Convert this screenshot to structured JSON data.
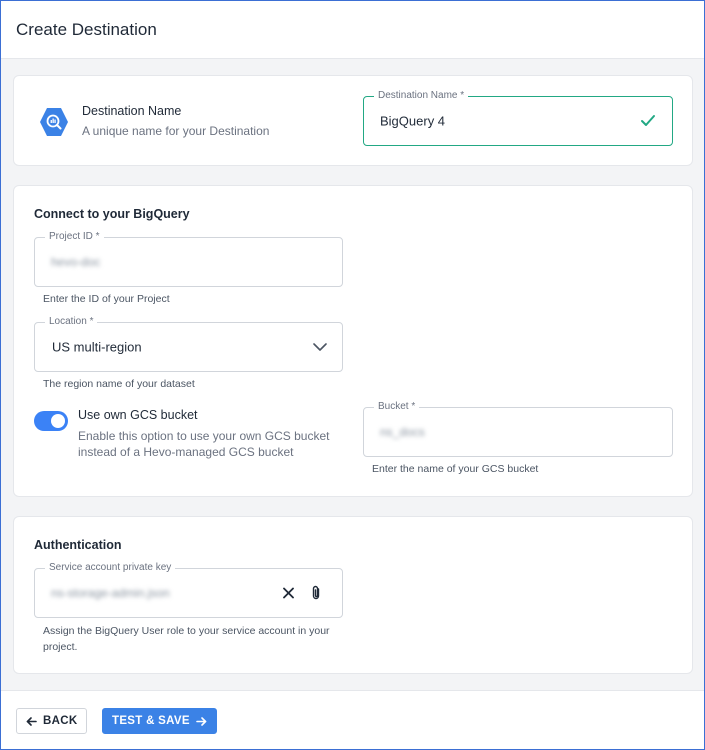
{
  "header": {
    "title": "Create Destination"
  },
  "destination": {
    "title": "Destination Name",
    "subtitle": "A unique name for your Destination",
    "field_label": "Destination Name *",
    "field_value": "BigQuery 4"
  },
  "connect": {
    "title": "Connect to your BigQuery",
    "project": {
      "label": "Project ID *",
      "value": "hevo-doc",
      "hint": "Enter the ID of your Project"
    },
    "location": {
      "label": "Location *",
      "value": "US multi-region",
      "hint": "The region name of your dataset"
    },
    "gcs": {
      "toggle_label": "Use own GCS bucket",
      "toggle_desc": "Enable this option to use your own GCS bucket instead of a Hevo-managed GCS bucket",
      "enabled": true
    },
    "bucket": {
      "label": "Bucket *",
      "value": "ns_docs",
      "hint": "Enter the name of your GCS bucket"
    }
  },
  "auth": {
    "title": "Authentication",
    "key": {
      "label": "Service account private key",
      "value": "ns-storage-admin.json",
      "hint": "Assign the BigQuery User role to your service account in your project."
    }
  },
  "footer": {
    "back_label": "BACK",
    "save_label": "TEST & SAVE"
  },
  "colors": {
    "accent": "#3b82e6",
    "valid": "#22a884",
    "border": "#d1d5db"
  }
}
